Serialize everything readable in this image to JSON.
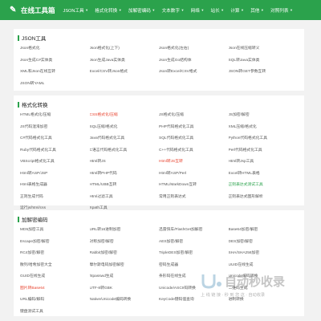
{
  "header": {
    "logo_text": "在线工具箱",
    "nav": [
      {
        "label": "JSON工具",
        "dropdown": true
      },
      {
        "label": "格式化转换",
        "dropdown": true
      },
      {
        "label": "加解密编码",
        "dropdown": true
      },
      {
        "label": "文本数字",
        "dropdown": true
      },
      {
        "label": "网络",
        "dropdown": true
      },
      {
        "label": "站长",
        "dropdown": true
      },
      {
        "label": "计算",
        "dropdown": true
      },
      {
        "label": "其他",
        "dropdown": true
      },
      {
        "label": "对照列表",
        "dropdown": true
      }
    ]
  },
  "sections": [
    {
      "title": "JSON工具",
      "links": [
        {
          "label": "Json格式化"
        },
        {
          "label": "Json格式化(上下)"
        },
        {
          "label": "Json格式化(左右)"
        },
        {
          "label": "Json在线压缩转义"
        },
        {
          "label": "Json生成C#实体类"
        },
        {
          "label": "Json生成Java实体类"
        },
        {
          "label": "Json生成Go结构体"
        },
        {
          "label": "SQL转Java实体类"
        },
        {
          "label": "XML和Json在线互转"
        },
        {
          "label": "Excel/CSV转Json格式"
        },
        {
          "label": "Json转Excel/CSV格式"
        },
        {
          "label": "JSON转GET参数互转"
        },
        {
          "label": "JSON转YAML"
        }
      ]
    },
    {
      "title": "格式化转换",
      "links": [
        {
          "label": "HTML格式化/压缩"
        },
        {
          "label": "CSS格式化/压缩",
          "style": "hot"
        },
        {
          "label": "JS格式化/压缩"
        },
        {
          "label": "JS加密/解密"
        },
        {
          "label": "JS代码混淆加密"
        },
        {
          "label": "SQL压缩/格式化"
        },
        {
          "label": "PHP代码格式化工具"
        },
        {
          "label": "XML压缩/格式化"
        },
        {
          "label": "C#代码格式化工具"
        },
        {
          "label": "Java代码格式化工具"
        },
        {
          "label": "SQL代码格式化工具"
        },
        {
          "label": "Python代码格式化工具"
        },
        {
          "label": "Ruby代码格式化工具"
        },
        {
          "label": "C语言代码格式化工具"
        },
        {
          "label": "C++代码格式化工具"
        },
        {
          "label": "Perl代码格式化工具"
        },
        {
          "label": "VBScript格式化工具"
        },
        {
          "label": "Html转JS"
        },
        {
          "label": "Html转JS互转",
          "style": "hot"
        },
        {
          "label": "Html转Jsp工具"
        },
        {
          "label": "Html转ASP/JSP"
        },
        {
          "label": "Html转PHP代码"
        },
        {
          "label": "Html转ASP/Perl"
        },
        {
          "label": "Excel转HTML表格"
        },
        {
          "label": "Html表格生成器"
        },
        {
          "label": "HTML/UBB互转"
        },
        {
          "label": "HTML/MarkDown互转"
        },
        {
          "label": "正则表达式测试工具",
          "style": "green"
        },
        {
          "label": "正则生成代码"
        },
        {
          "label": "Html过滤工具"
        },
        {
          "label": "常用正则表达式"
        },
        {
          "label": "正则表达式图形解析"
        },
        {
          "label": "运行js/html/css"
        },
        {
          "label": "Xpath工具"
        }
      ]
    },
    {
      "title": "加解密编码",
      "links": [
        {
          "label": "MD5加密工具"
        },
        {
          "label": "URL转16进制加密"
        },
        {
          "label": "迅雷快车/FlashGet加解密"
        },
        {
          "label": "Base64加密/解密"
        },
        {
          "label": "Escape加密/解密"
        },
        {
          "label": "对称加密/解密"
        },
        {
          "label": "AES加密/解密"
        },
        {
          "label": "DES加密/解密"
        },
        {
          "label": "RC4加密/解密"
        },
        {
          "label": "Rabbit加密/解密"
        },
        {
          "label": "TripleDES加密/解密"
        },
        {
          "label": "SHA/SHA256加密"
        },
        {
          "label": "散列/哈希加密大全"
        },
        {
          "label": "摩尔斯电码加密解密"
        },
        {
          "label": "密码生成器"
        },
        {
          "label": "UUID在线生成"
        },
        {
          "label": "GUID在线生成"
        },
        {
          "label": "htpasswd生成"
        },
        {
          "label": "条形码在线生成"
        },
        {
          "label": "Unicode编码转换"
        },
        {
          "label": "图片转Base64",
          "style": "hot"
        },
        {
          "label": "UTF-8转GBK"
        },
        {
          "label": "Unicode/ASCII码转换"
        },
        {
          "label": "二维码生成"
        },
        {
          "label": "URL编码/解码"
        },
        {
          "label": "Native/Unicode编码转换"
        },
        {
          "label": "KeyCode键码值查询"
        },
        {
          "label": "进制转换"
        },
        {
          "label": "键盘测试工具"
        }
      ]
    }
  ],
  "watermark": {
    "title": "自动秒收录",
    "subtitle": "上 线 链 接 · 秒 到 您 这 · 自动收录"
  }
}
